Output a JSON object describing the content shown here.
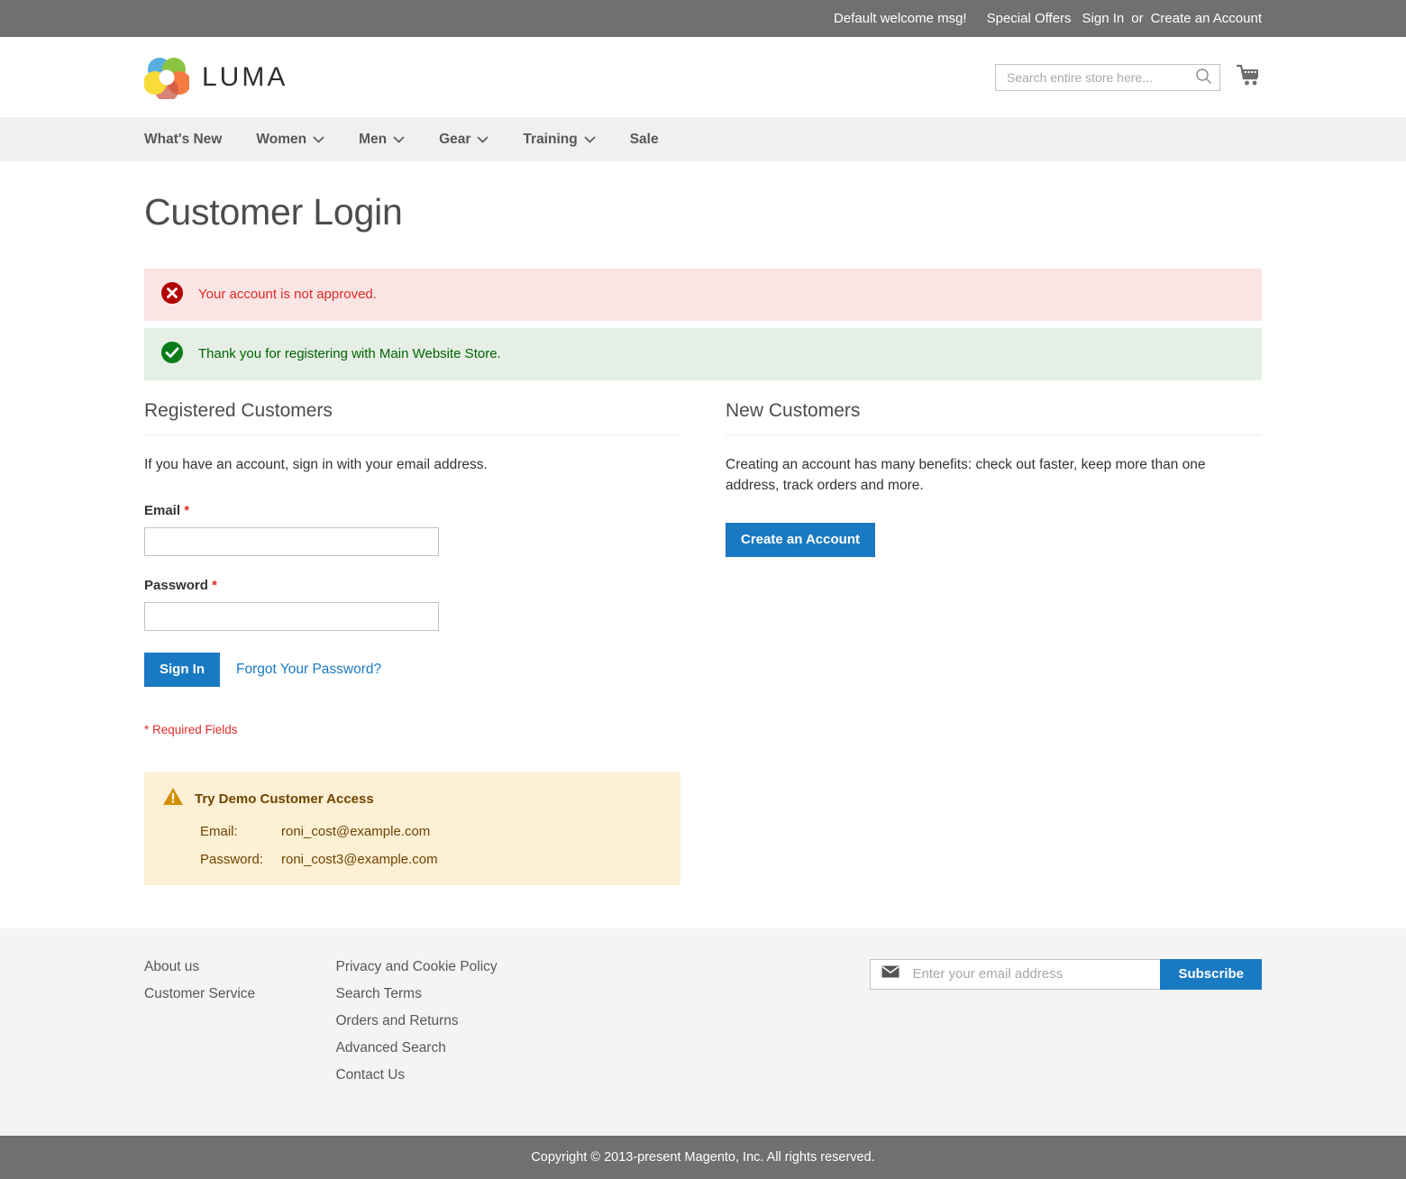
{
  "colors": {
    "accent": "#1979c3",
    "panel_bg": "#6e716e",
    "nav_bg": "#f0f0f0",
    "footer_bg": "#f4f4f4",
    "error_bg": "#fae5e5",
    "error_text": "#e02b27",
    "success_bg": "#e5efe5",
    "success_text": "#006400",
    "demo_bg": "#fdf0d5",
    "demo_text": "#6f4400"
  },
  "panel": {
    "welcome": "Default welcome msg!",
    "special_offers": "Special Offers",
    "sign_in": "Sign In",
    "or": "or",
    "create_account": "Create an Account"
  },
  "header": {
    "logo_text": "LUMA",
    "logo_icon": "luma-logo-icon",
    "search_placeholder": "Search entire store here...",
    "search_value": "",
    "search_icon": "search-icon",
    "cart_icon": "shopping-cart-icon"
  },
  "nav": {
    "items": [
      {
        "label": "What's New",
        "has_caret": false
      },
      {
        "label": "Women",
        "has_caret": true
      },
      {
        "label": "Men",
        "has_caret": true
      },
      {
        "label": "Gear",
        "has_caret": true
      },
      {
        "label": "Training",
        "has_caret": true
      },
      {
        "label": "Sale",
        "has_caret": false
      }
    ]
  },
  "page": {
    "title": "Customer Login"
  },
  "messages": [
    {
      "type": "error",
      "icon": "error-circle-icon",
      "text": "Your account is not approved."
    },
    {
      "type": "success",
      "icon": "success-check-icon",
      "text": "Thank you for registering with Main Website Store."
    }
  ],
  "registered": {
    "title": "Registered Customers",
    "note": "If you have an account, sign in with your email address.",
    "email_label": "Email",
    "email_value": "",
    "password_label": "Password",
    "password_value": "",
    "required_mark": "*",
    "sign_in_button": "Sign In",
    "forgot_link": "Forgot Your Password?",
    "required_note": "* Required Fields"
  },
  "new_customers": {
    "title": "New Customers",
    "note": "Creating an account has many benefits: check out faster, keep more than one address, track orders and more.",
    "create_button": "Create an Account"
  },
  "demo": {
    "icon": "warning-triangle-icon",
    "title": "Try Demo Customer Access",
    "email_label": "Email:",
    "email_value": "roni_cost@example.com",
    "password_label": "Password:",
    "password_value": "roni_cost3@example.com"
  },
  "footer": {
    "col1": [
      {
        "label": "About us"
      },
      {
        "label": "Customer Service"
      }
    ],
    "col2": [
      {
        "label": "Privacy and Cookie Policy"
      },
      {
        "label": "Search Terms"
      },
      {
        "label": "Orders and Returns"
      },
      {
        "label": "Advanced Search"
      },
      {
        "label": "Contact Us"
      }
    ],
    "newsletter": {
      "icon": "envelope-icon",
      "placeholder": "Enter your email address",
      "value": "",
      "subscribe_button": "Subscribe"
    },
    "copyright": "Copyright © 2013-present Magento, Inc. All rights reserved."
  }
}
